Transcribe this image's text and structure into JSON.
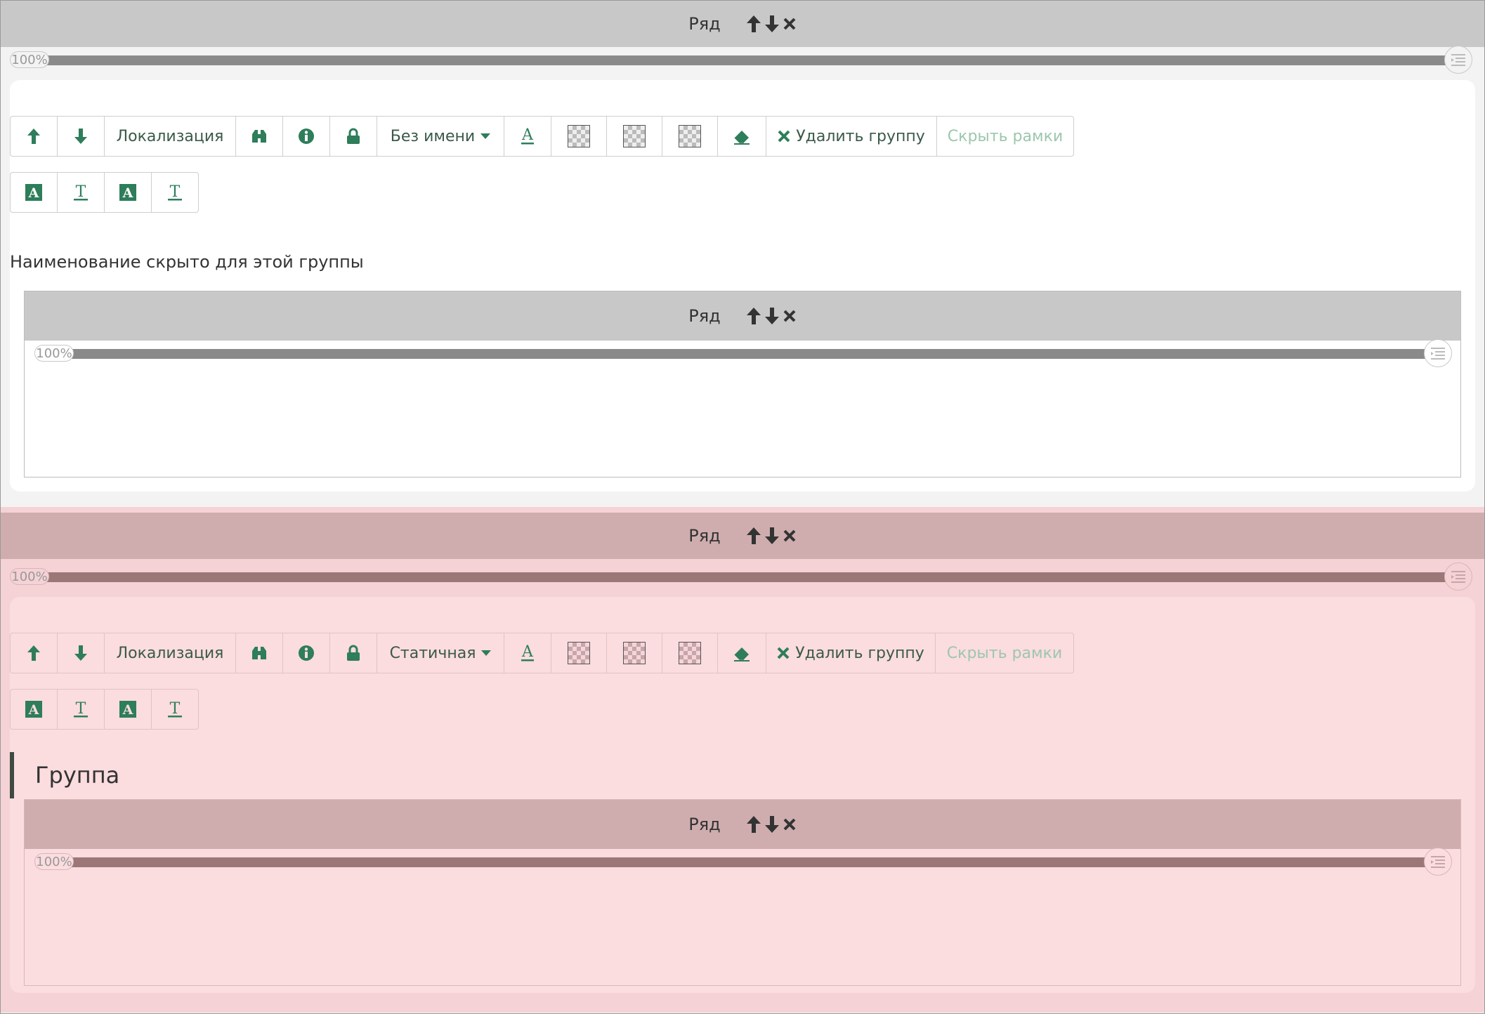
{
  "colors": {
    "green": "#2e7d5b",
    "grey_bar": "#c8c8c8",
    "grey_track": "#8a8a8a",
    "pink_bar": "#cfadaf",
    "pink_track": "#9b7778",
    "pink_panel": "#fbdcdf",
    "pink_bg": "#f5d2d5"
  },
  "row_label": "Ряд",
  "slider_value": "100%",
  "toolbar": {
    "localization": "Локализация",
    "delete_group": "Удалить группу",
    "hide_frames": "Скрыть рамки"
  },
  "group1": {
    "name_select": "Без имени",
    "hidden_note": "Наименование скрыто для этой группы"
  },
  "group2": {
    "name_select": "Статичная",
    "title": "Группа"
  }
}
